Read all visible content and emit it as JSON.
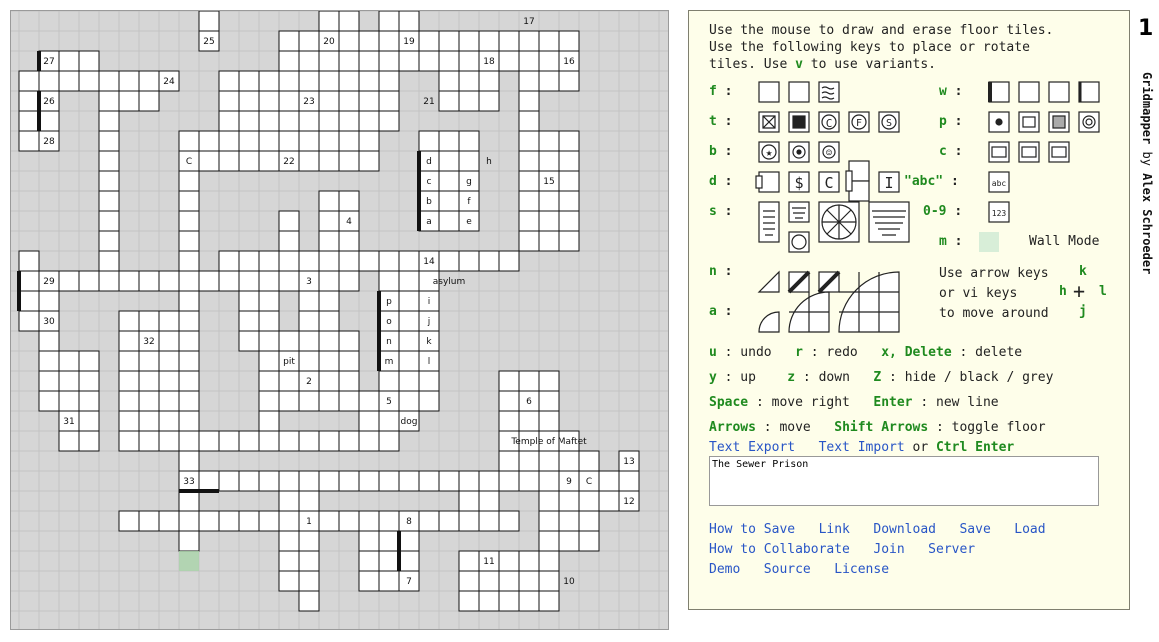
{
  "help": {
    "intro": [
      "Use the mouse to draw and erase floor tiles.",
      "Use the following keys to place or rotate",
      "tiles. Use",
      "v",
      "to use variants."
    ],
    "keys": {
      "f": "f",
      "t": "t",
      "b": "b",
      "d": "d",
      "s": "s",
      "n": "n",
      "a": "a",
      "w": "w",
      "p": "p",
      "c": "c",
      "num": "0-9",
      "m": "m"
    },
    "abc_label": "\"abc\"",
    "abc_tile": "abc",
    "num_tile": "123",
    "wall_mode": "Wall Mode",
    "arrow_text": [
      "Use arrow keys",
      "or vi keys",
      "to move around"
    ],
    "vi_keys": {
      "k": "k",
      "h": "h",
      "l": "l",
      "j": "j"
    },
    "commands": [
      [
        {
          "k": "u"
        },
        {
          "t": " : undo   "
        },
        {
          "k": "r"
        },
        {
          "t": " : redo   "
        },
        {
          "k": "x, Delete"
        },
        {
          "t": " : delete"
        }
      ],
      [
        {
          "k": "y"
        },
        {
          "t": " : up    "
        },
        {
          "k": "z"
        },
        {
          "t": " : down   "
        },
        {
          "k": "Z"
        },
        {
          "t": " : hide / black / grey"
        }
      ],
      [
        {
          "k": "Space"
        },
        {
          "t": " : move right   "
        },
        {
          "k": "Enter"
        },
        {
          "t": " : new line"
        }
      ],
      [
        {
          "k": "Arrows"
        },
        {
          "t": " : move   "
        },
        {
          "k": "Shift Arrows"
        },
        {
          "t": " : toggle floor"
        }
      ]
    ],
    "text_export": "Text Export",
    "text_import": "Text Import",
    "or": "or",
    "ctrl_enter": "Ctrl Enter",
    "textarea_value": "The Sewer Prison",
    "links_row1": [
      "How to Save",
      "Link",
      "Download",
      "Save",
      "Load"
    ],
    "links_row2": [
      "How to Collaborate",
      "Join",
      "Server"
    ],
    "links_row3": [
      "Demo",
      "Source",
      "License"
    ]
  },
  "side": {
    "page_number": "1",
    "title": "Gridmapper",
    "by": "by",
    "author": "Alex Schroeder"
  },
  "map": {
    "labels": [
      {
        "t": "25",
        "c": 9,
        "r": 1
      },
      {
        "t": "20",
        "c": 15,
        "r": 1
      },
      {
        "t": "19",
        "c": 19,
        "r": 1
      },
      {
        "t": "17",
        "c": 25,
        "r": 0
      },
      {
        "t": "27",
        "c": 1,
        "r": 2
      },
      {
        "t": "18",
        "c": 23,
        "r": 2
      },
      {
        "t": "16",
        "c": 27,
        "r": 2
      },
      {
        "t": "24",
        "c": 7,
        "r": 3
      },
      {
        "t": "26",
        "c": 1,
        "r": 4
      },
      {
        "t": "23",
        "c": 14,
        "r": 4
      },
      {
        "t": "21",
        "c": 20,
        "r": 4
      },
      {
        "t": "28",
        "c": 1,
        "r": 6
      },
      {
        "t": "22",
        "c": 13,
        "r": 7
      },
      {
        "t": "15",
        "c": 26,
        "r": 8
      },
      {
        "t": "4",
        "c": 16,
        "r": 10
      },
      {
        "t": "14",
        "c": 20,
        "r": 12
      },
      {
        "t": "29",
        "c": 1,
        "r": 13
      },
      {
        "t": "3",
        "c": 14,
        "r": 13
      },
      {
        "t": "30",
        "c": 1,
        "r": 15
      },
      {
        "t": "32",
        "c": 6,
        "r": 16
      },
      {
        "t": "2",
        "c": 14,
        "r": 18
      },
      {
        "t": "31",
        "c": 2,
        "r": 20
      },
      {
        "t": "5",
        "c": 18,
        "r": 19
      },
      {
        "t": "6",
        "c": 25,
        "r": 19
      },
      {
        "t": "13",
        "c": 30,
        "r": 22
      },
      {
        "t": "9",
        "c": 27,
        "r": 23
      },
      {
        "t": "33",
        "c": 8,
        "r": 23
      },
      {
        "t": "12",
        "c": 30,
        "r": 24
      },
      {
        "t": "1",
        "c": 14,
        "r": 25
      },
      {
        "t": "8",
        "c": 19,
        "r": 25
      },
      {
        "t": "7",
        "c": 19,
        "r": 28
      },
      {
        "t": "11",
        "c": 23,
        "r": 27
      },
      {
        "t": "10",
        "c": 27,
        "r": 28
      },
      {
        "t": "d",
        "c": 20,
        "r": 7
      },
      {
        "t": "c",
        "c": 20,
        "r": 8
      },
      {
        "t": "b",
        "c": 20,
        "r": 9
      },
      {
        "t": "a",
        "c": 20,
        "r": 10
      },
      {
        "t": "g",
        "c": 22,
        "r": 8
      },
      {
        "t": "f",
        "c": 22,
        "r": 9
      },
      {
        "t": "e",
        "c": 22,
        "r": 10
      },
      {
        "t": "h",
        "c": 23,
        "r": 7
      },
      {
        "t": "p",
        "c": 18,
        "r": 14
      },
      {
        "t": "o",
        "c": 18,
        "r": 15
      },
      {
        "t": "n",
        "c": 18,
        "r": 16
      },
      {
        "t": "m",
        "c": 18,
        "r": 17
      },
      {
        "t": "i",
        "c": 20,
        "r": 14
      },
      {
        "t": "j",
        "c": 20,
        "r": 15
      },
      {
        "t": "k",
        "c": 20,
        "r": 16
      },
      {
        "t": "l",
        "c": 20,
        "r": 17
      },
      {
        "t": "asylum",
        "c": 21,
        "r": 13
      },
      {
        "t": "pit",
        "c": 13,
        "r": 17
      },
      {
        "t": "dog",
        "c": 19,
        "r": 20
      },
      {
        "t": "Temple of Maftet",
        "c": 26,
        "r": 21
      },
      {
        "t": "C",
        "c": 8,
        "r": 7
      },
      {
        "t": "C",
        "c": 28,
        "r": 23
      }
    ]
  },
  "colors": {
    "key_green": "#1f8a1f",
    "link_blue": "#2855c6",
    "panel_bg": "#fefeea",
    "map_bg": "#d6d6d6"
  }
}
